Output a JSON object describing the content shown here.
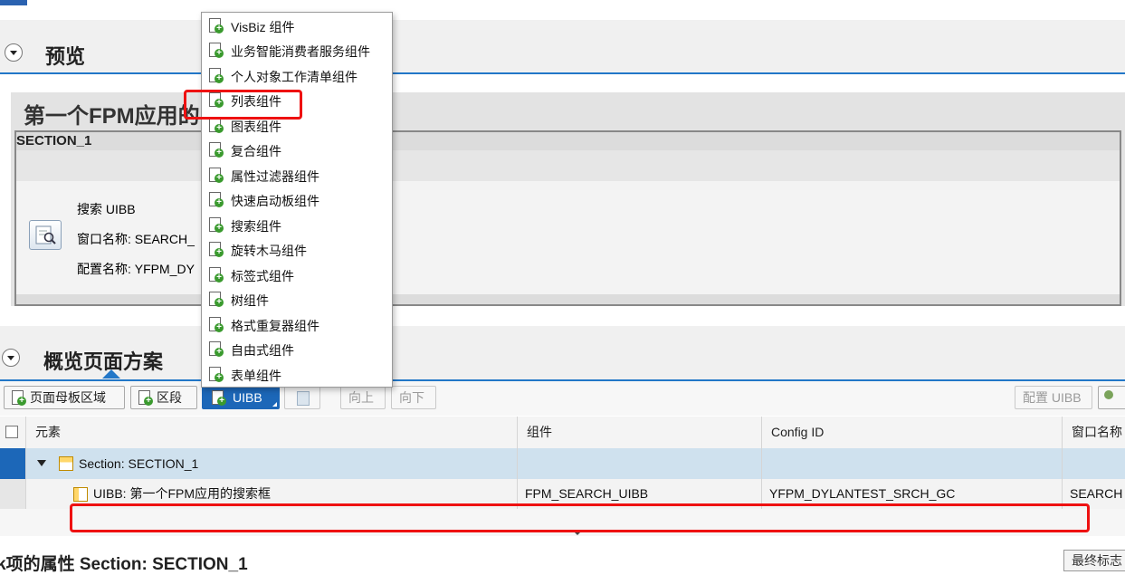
{
  "preview_panel": {
    "title": "预览"
  },
  "preview": {
    "app_title": "第一个FPM应用的",
    "section_name": "SECTION_1",
    "uibb_label": "搜索 UIBB",
    "window_name": "窗口名称: SEARCH_",
    "config_name": "配置名称: YFPM_DY"
  },
  "overview_panel": {
    "title": "概览页面方案"
  },
  "toolbar": {
    "add_master_area": "页面母板区域",
    "add_section": "区段",
    "uibb": "UIBB",
    "move_up": "向上",
    "move_down": "向下",
    "configure_uibb": "配置 UIBB"
  },
  "grid": {
    "columns": [
      "元素",
      "组件",
      "Config ID",
      "窗口名称"
    ],
    "rows": [
      {
        "element": "Section: SECTION_1",
        "component": "",
        "config_id": "",
        "window": ""
      },
      {
        "element": "UIBB: 第一个FPM应用的搜索框",
        "component": "FPM_SEARCH_UIBB",
        "config_id": "YFPM_DYLANTEST_SRCH_GC",
        "window": "SEARCH"
      }
    ]
  },
  "properties": {
    "title": "k项的属性 Section: SECTION_1",
    "final_button": "最终标志"
  },
  "uibb_menu": {
    "items": [
      "VisBiz 组件",
      "业务智能消费者服务组件",
      "个人对象工作清单组件",
      "列表组件",
      "图表组件",
      "复合组件",
      "属性过滤器组件",
      "快速启动板组件",
      "搜索组件",
      "旋转木马组件",
      "标签式组件",
      "树组件",
      "格式重复器组件",
      "自由式组件",
      "表单组件"
    ]
  },
  "colors": {
    "accent": "#2277c8",
    "highlight": "#ee1111",
    "selected": "#1c67b8"
  }
}
